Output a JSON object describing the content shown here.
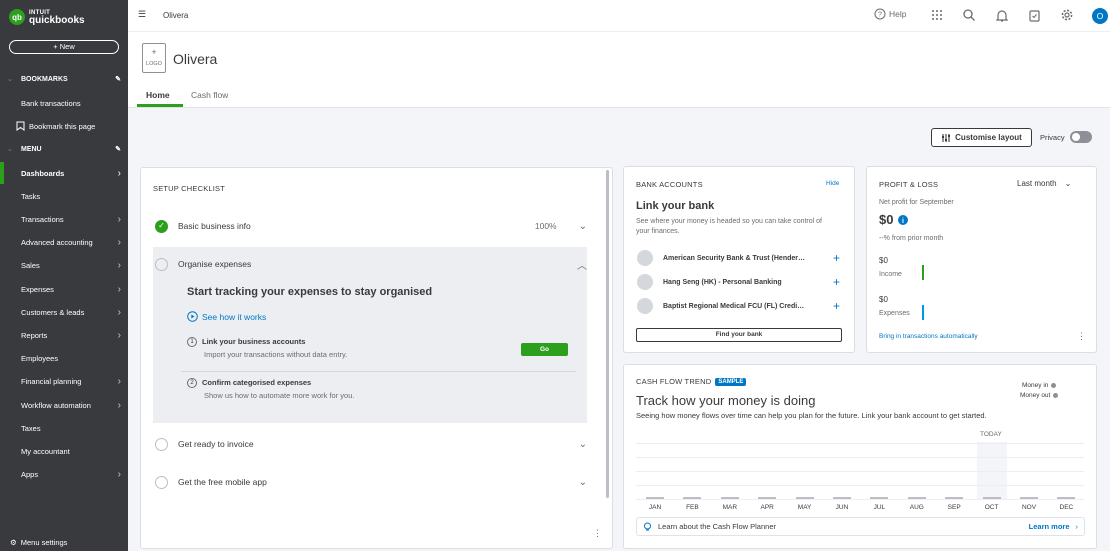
{
  "app": {
    "logo_top": "intuit",
    "logo_bottom": "quickbooks",
    "logo_mark": "qb"
  },
  "sidebar": {
    "new_label": "+ New",
    "bookmarks_header": "BOOKMARKS",
    "bookmarks": [
      "Bank transactions",
      "Bookmark this page"
    ],
    "menu_header": "MENU",
    "items": [
      {
        "label": "Dashboards",
        "arrow": true,
        "active": true
      },
      {
        "label": "Tasks",
        "arrow": false
      },
      {
        "label": "Transactions",
        "arrow": true
      },
      {
        "label": "Advanced accounting",
        "arrow": true
      },
      {
        "label": "Sales",
        "arrow": true
      },
      {
        "label": "Expenses",
        "arrow": true
      },
      {
        "label": "Customers & leads",
        "arrow": true
      },
      {
        "label": "Reports",
        "arrow": true
      },
      {
        "label": "Employees",
        "arrow": false
      },
      {
        "label": "Financial planning",
        "arrow": true
      },
      {
        "label": "Workflow automation",
        "arrow": true
      },
      {
        "label": "Taxes",
        "arrow": false
      },
      {
        "label": "My accountant",
        "arrow": false
      },
      {
        "label": "Apps",
        "arrow": true
      }
    ],
    "menu_settings": "Menu settings"
  },
  "topbar": {
    "company": "Olivera",
    "help": "Help",
    "avatar": "O"
  },
  "header": {
    "logo_plus": "+",
    "logo_label": "LOGO",
    "company": "Olivera",
    "tabs": [
      "Home",
      "Cash flow"
    ],
    "customise": "Customise layout",
    "privacy": "Privacy"
  },
  "setup": {
    "title": "SETUP CHECKLIST",
    "basic": "Basic business info",
    "basic_pct": "100%",
    "organise": "Organise expenses",
    "headline": "Start tracking your expenses to stay organised",
    "see_how": "See how it works",
    "step1_num": "1",
    "step1_title": "Link your business accounts",
    "step1_desc": "Import your transactions without data entry.",
    "go": "Go",
    "step2_num": "2",
    "step2_title": "Confirm categorised expenses",
    "step2_desc": "Show us how to automate more work for you.",
    "invoice": "Get ready to invoice",
    "mobile": "Get the free mobile app"
  },
  "bank": {
    "title": "BANK ACCOUNTS",
    "hide": "Hide",
    "headline": "Link your bank",
    "desc": "See where your money is headed so you can take control of your finances.",
    "banks": [
      "American Security Bank & Trust (Hender…",
      "Hang Seng (HK) - Personal Banking",
      "Baptist Regional Medical FCU (FL) Credi…"
    ],
    "find": "Find your bank"
  },
  "pnl": {
    "title": "PROFIT & LOSS",
    "period": "Last month",
    "net_label": "Net profit for September",
    "net_value": "$0",
    "change": "--% from prior month",
    "income_value": "$0",
    "income_label": "Income",
    "expenses_value": "$0",
    "expenses_label": "Expenses",
    "link": "Bring in transactions automatically"
  },
  "cash": {
    "title": "CASH FLOW TREND",
    "badge": "SAMPLE",
    "headline": "Track how your money is doing",
    "desc": "Seeing how money flows over time can help you plan for the future. Link your bank account to get started.",
    "legend_in": "Money in",
    "legend_out": "Money out",
    "today": "TODAY",
    "months": [
      "JAN",
      "FEB",
      "MAR",
      "APR",
      "MAY",
      "JUN",
      "JUL",
      "AUG",
      "SEP",
      "OCT",
      "NOV",
      "DEC"
    ],
    "learn": "Learn about the Cash Flow Planner",
    "learn_more": "Learn more"
  },
  "colors": {
    "brand_green": "#2ca01c",
    "link_blue": "#0077c5",
    "sidebar": "#393a3d"
  }
}
